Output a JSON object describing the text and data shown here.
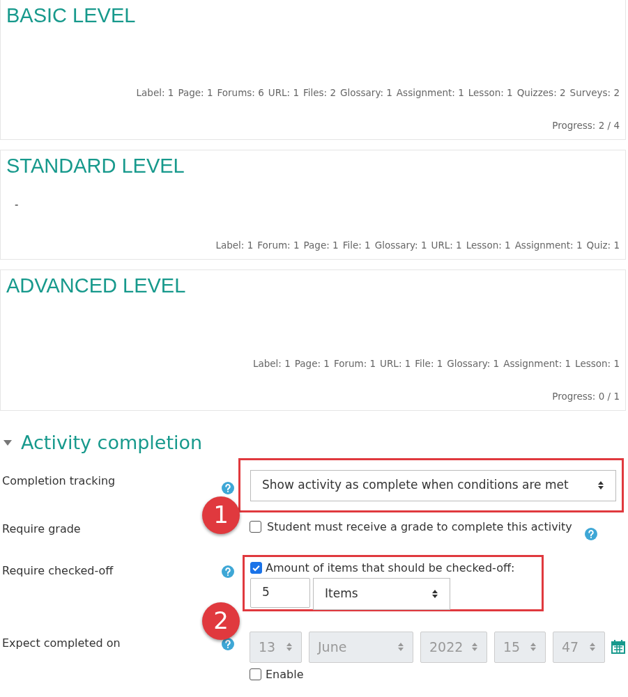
{
  "sections": [
    {
      "title": "BASIC LEVEL",
      "counts": [
        "Label: 1",
        "Page: 1",
        "Forums: 6",
        "URL: 1",
        "Files: 2",
        "Glossary: 1",
        "Assignment: 1",
        "Lesson: 1",
        "Quizzes: 2",
        "Surveys: 2"
      ],
      "progress": "Progress: 2 / 4"
    },
    {
      "title": "STANDARD LEVEL",
      "summary": "-",
      "counts": [
        "Label: 1",
        "Forum: 1",
        "Page: 1",
        "File: 1",
        "Glossary: 1",
        "URL: 1",
        "Lesson: 1",
        "Assignment: 1",
        "Quiz: 1"
      ]
    },
    {
      "title": "ADVANCED LEVEL",
      "counts": [
        "Label: 1",
        "Page: 1",
        "Forum: 1",
        "URL: 1",
        "File: 1",
        "Glossary: 1",
        "Assignment: 1",
        "Lesson: 1"
      ],
      "progress": "Progress: 0 / 1"
    }
  ],
  "form": {
    "title": "Activity completion",
    "expanded": true,
    "completion_tracking": {
      "label": "Completion tracking",
      "value": "Show activity as complete when conditions are met",
      "marker": "1"
    },
    "require_grade": {
      "label": "Require grade",
      "checkbox": "Student must receive a grade to complete this activity",
      "checked": false
    },
    "require_checked_off": {
      "label": "Require checked-off",
      "checkbox": "Amount of items that should be checked-off:",
      "checked": true,
      "amount": "5",
      "unit": "Items",
      "marker": "2"
    },
    "expect_completed": {
      "label": "Expect completed on",
      "day": "13",
      "month": "June",
      "year": "2022",
      "hour": "15",
      "minute": "47",
      "disabled": true,
      "enable_label": "Enable",
      "enable_checked": false
    }
  }
}
